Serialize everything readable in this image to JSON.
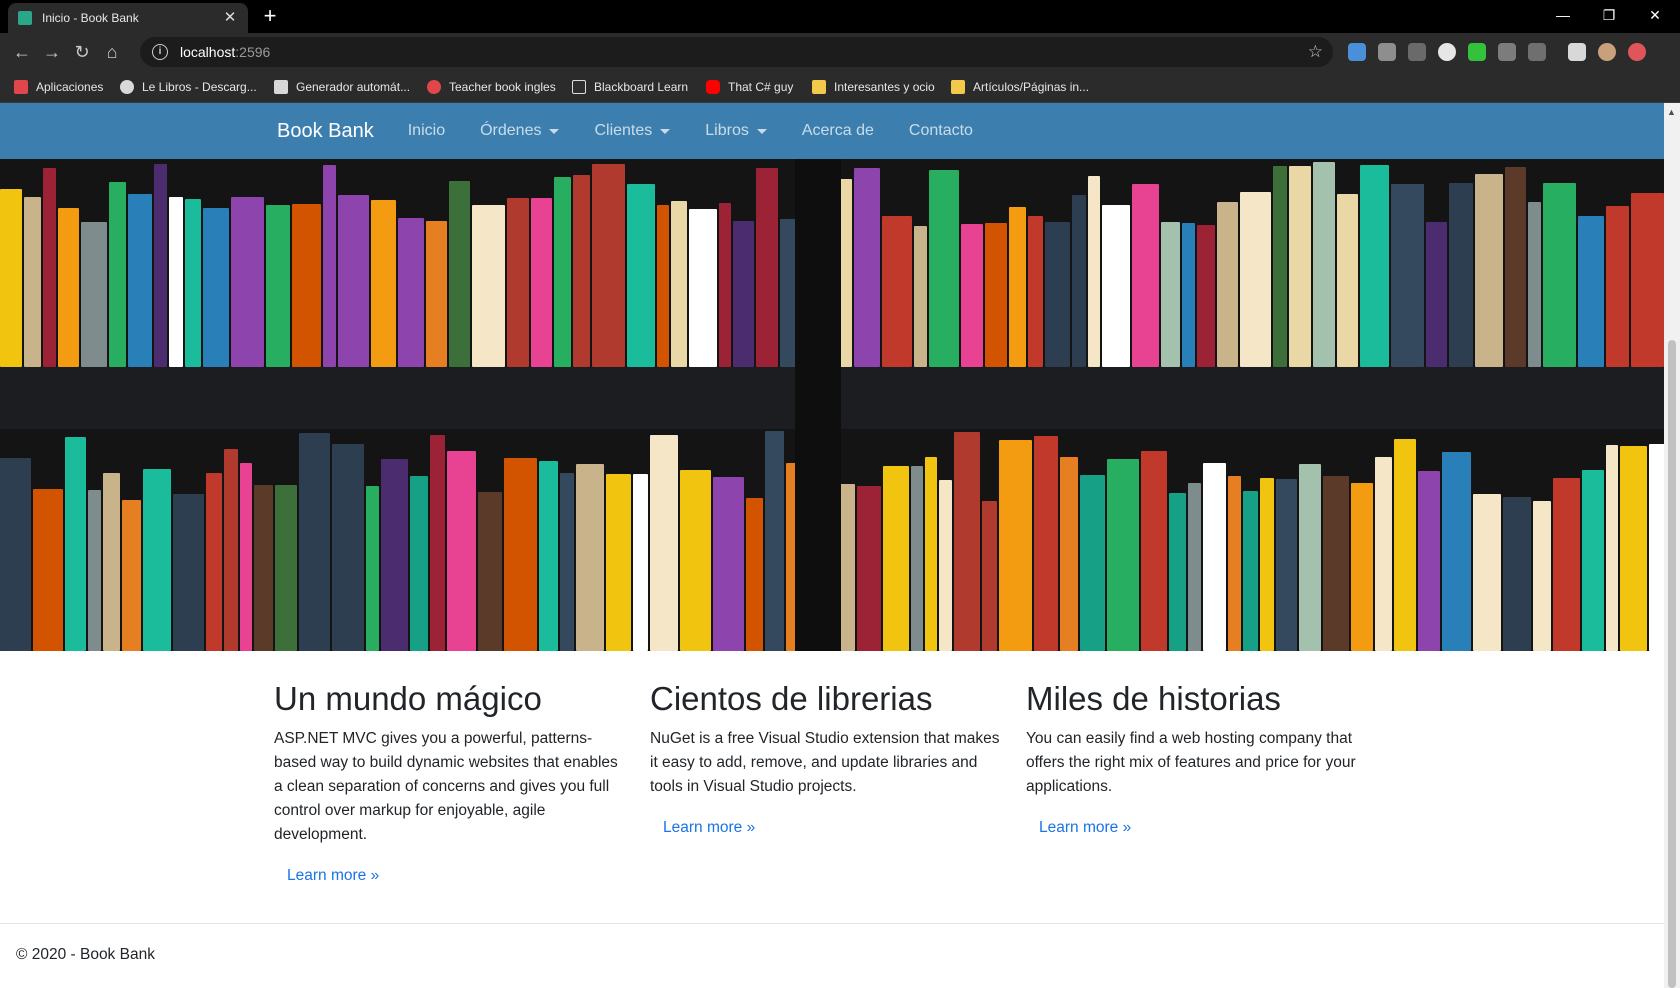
{
  "browser": {
    "tab_title": "Inicio - Book Bank",
    "url_host": "localhost",
    "url_port": ":2596",
    "bookmarks": [
      {
        "label": "Aplicaciones",
        "color": "#e0464b"
      },
      {
        "label": "Le Libros - Descarg...",
        "color": "#d9d9d9"
      },
      {
        "label": "Generador automát...",
        "color": "#d8d8d8"
      },
      {
        "label": "Teacher book ingles",
        "color": "#e1464b"
      },
      {
        "label": "Blackboard Learn",
        "color": "#2e2e2e"
      },
      {
        "label": "That C# guy",
        "color": "#ff0000"
      },
      {
        "label": "Interesantes y ocio",
        "color": "#f3c94c"
      },
      {
        "label": "Artículos/Páginas in...",
        "color": "#f3c94c"
      }
    ]
  },
  "navbar": {
    "brand": "Book Bank",
    "links": [
      {
        "label": "Inicio",
        "dropdown": false
      },
      {
        "label": "Órdenes",
        "dropdown": true
      },
      {
        "label": "Clientes",
        "dropdown": true
      },
      {
        "label": "Libros",
        "dropdown": true
      },
      {
        "label": "Acerca de",
        "dropdown": false
      },
      {
        "label": "Contacto",
        "dropdown": false
      }
    ],
    "color": "#3c7fae"
  },
  "columns": [
    {
      "heading": "Un mundo mágico",
      "body": "ASP.NET MVC gives you a powerful, patterns-based way to build dynamic websites that enables a clean separation of concerns and gives you full control over markup for enjoyable, agile development.",
      "link": "Learn more »"
    },
    {
      "heading": "Cientos de librerias",
      "body": "NuGet is a free Visual Studio extension that makes it easy to add, remove, and update libraries and tools in Visual Studio projects.",
      "link": "Learn more »"
    },
    {
      "heading": "Miles de historias",
      "body": "You can easily find a web hosting company that offers the right mix of features and price for your applications.",
      "link": "Learn more »"
    }
  ],
  "footer": {
    "text": "© 2020 - Book Bank"
  }
}
